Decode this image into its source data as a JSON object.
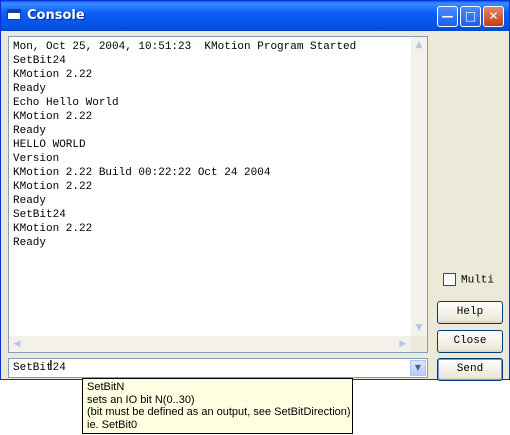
{
  "window": {
    "title": "Console",
    "controls": {
      "minimize": "minimize",
      "maximize": "maximize",
      "close": "close"
    }
  },
  "console": {
    "lines": [
      "Mon, Oct 25, 2004, 10:51:23  KMotion Program Started",
      "SetBit24",
      "KMotion 2.22",
      "Ready",
      "Echo Hello World",
      "KMotion 2.22",
      "Ready",
      "HELLO WORLD",
      "Version",
      "KMotion 2.22 Build 00:22:22 Oct 24 2004",
      "KMotion 2.22",
      "Ready",
      "SetBit24",
      "KMotion 2.22",
      "Ready"
    ]
  },
  "options": {
    "multi_label": "Multi",
    "multi_checked": false
  },
  "buttons": {
    "help": "Help",
    "close": "Close",
    "send": "Send"
  },
  "command": {
    "value": "SetBit24"
  },
  "tooltip": {
    "lines": [
      "SetBitN",
      "sets an IO bit N(0..30)",
      "(bit must be defined as an output, see SetBitDirection)",
      "ie. SetBit0"
    ]
  }
}
